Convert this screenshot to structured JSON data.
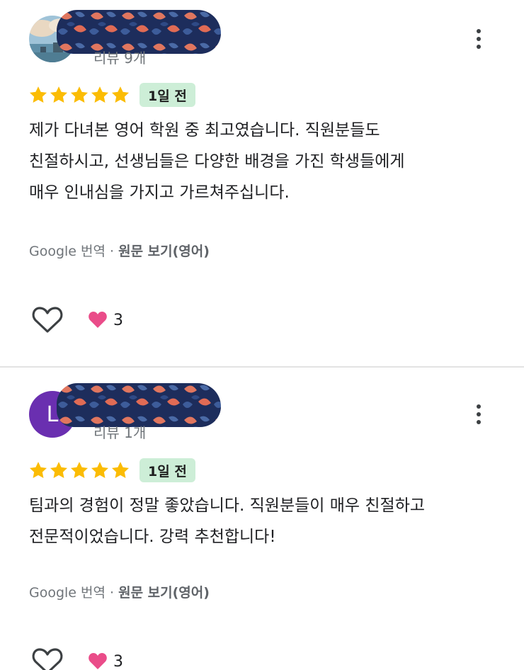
{
  "reviews": [
    {
      "avatar_type": "photo",
      "review_count": "리뷰 9개",
      "rating": 5,
      "date_badge": "1일 전",
      "text_lines": [
        "제가 다녀본 영어 학원 중 최고였습니다. 직원분들도",
        "친절하시고, 선생님들은 다양한 배경을 가진 학생들에게",
        "매우 인내심을 가지고 가르쳐주십니다."
      ],
      "translation_label": "Google 번역 ·",
      "original_label": "원문 보기(영어)",
      "reaction_emoji": "heart",
      "reaction_count": "3"
    },
    {
      "avatar_type": "letter",
      "avatar_letter": "L",
      "avatar_color": "#6a2fb0",
      "review_count": "리뷰 1개",
      "rating": 5,
      "date_badge": "1일 전",
      "text_lines": [
        "팀과의 경험이 정말 좋았습니다. 직원분들이 매우 친절하고",
        "전문적이었습니다. 강력 추천합니다!"
      ],
      "translation_label": "Google 번역 ·",
      "original_label": "원문 보기(영어)",
      "reaction_emoji": "heart",
      "reaction_count": "3"
    }
  ],
  "colors": {
    "star": "#fbbc04",
    "badge_bg": "#cdeed7",
    "heart_reaction": "#ea4c89",
    "avatar_letter_bg": "#6a2fb0"
  },
  "icons": [
    "kebab-menu-icon",
    "star-icon",
    "heart-outline-icon",
    "heart-filled-icon"
  ]
}
